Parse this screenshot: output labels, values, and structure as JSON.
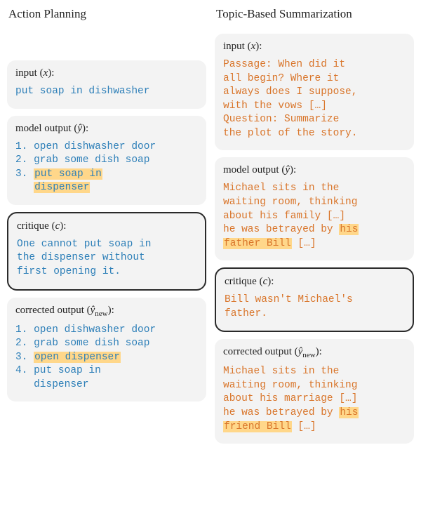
{
  "left": {
    "title": "Action Planning",
    "input": {
      "label_prefix": "input (",
      "label_var": "x",
      "label_suffix": "):",
      "text": "put soap in dishwasher"
    },
    "model_output": {
      "label_prefix": "model output (",
      "label_var": "ŷ",
      "label_suffix": "):",
      "line1": "1. open dishwasher door",
      "line2": "2. grab some dish soap",
      "line3_pre": "3. ",
      "line3_hl1": "put soap in",
      "line3_br": "   ",
      "line3_hl2": "dispenser"
    },
    "critique": {
      "label_prefix": "critique (",
      "label_var": "c",
      "label_suffix": "):",
      "text": "One cannot put soap in\nthe dispenser without\nfirst opening it."
    },
    "corrected": {
      "label_prefix": "corrected output (",
      "label_var": "ŷ",
      "label_sub": "new",
      "label_suffix": "):",
      "line1": "1. open dishwasher door",
      "line2": "2. grab some dish soap",
      "line3_pre": "3. ",
      "line3_hl": "open dispenser",
      "line4": "4. put soap in\n   dispenser"
    }
  },
  "right": {
    "title": "Topic-Based Summarization",
    "input": {
      "label_prefix": "input (",
      "label_var": "x",
      "label_suffix": "):",
      "text": "Passage: When did it\nall begin? Where it\nalways does I suppose,\nwith the vows […]\nQuestion: Summarize\nthe plot of the story."
    },
    "model_output": {
      "label_prefix": "model output (",
      "label_var": "ŷ",
      "label_suffix": "):",
      "pre": "Michael sits in the\nwaiting room, thinking\nabout his family […]\nhe was betrayed by ",
      "hl1": "his",
      "br": "\n",
      "hl2": "father Bill",
      "post": " […]"
    },
    "critique": {
      "label_prefix": "critique (",
      "label_var": "c",
      "label_suffix": "):",
      "text": "Bill wasn't Michael's\nfather."
    },
    "corrected": {
      "label_prefix": "corrected output (",
      "label_var": "ŷ",
      "label_sub": "new",
      "label_suffix": "):",
      "pre": "Michael sits in the\nwaiting room, thinking\nabout his marriage […]\nhe was betrayed by ",
      "hl1": "his",
      "br": "\n",
      "hl2": "friend Bill",
      "post": " […]"
    }
  }
}
